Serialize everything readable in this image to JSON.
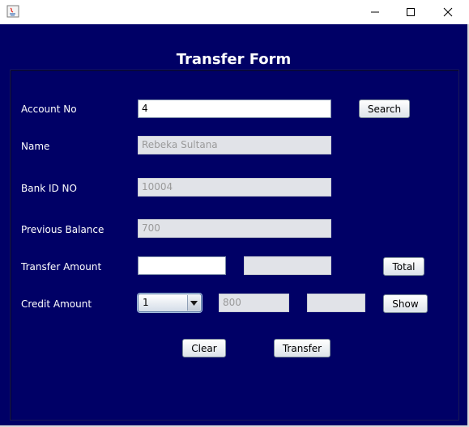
{
  "window": {
    "title": "",
    "controls": [
      "minimize-icon",
      "maximize-icon",
      "close-icon"
    ]
  },
  "form": {
    "title": "Transfer Form",
    "labels": {
      "account_no": "Account No",
      "name": "Name",
      "bank_id": "Bank ID NO",
      "previous_balance": "Previous Balance",
      "transfer_amount": "Transfer Amount",
      "credit_amount": "Credit Amount"
    },
    "values": {
      "account_no": "4",
      "name": "Rebeka Sultana",
      "bank_id": "10004",
      "previous_balance": "700",
      "transfer_amount": "",
      "transfer_total": "",
      "credit_selected": "1",
      "credit_value": "800",
      "credit_result": ""
    },
    "buttons": {
      "search": "Search",
      "total": "Total",
      "show": "Show",
      "clear": "Clear",
      "transfer": "Transfer"
    }
  },
  "colors": {
    "background": "#000066",
    "text": "#ffffff"
  }
}
